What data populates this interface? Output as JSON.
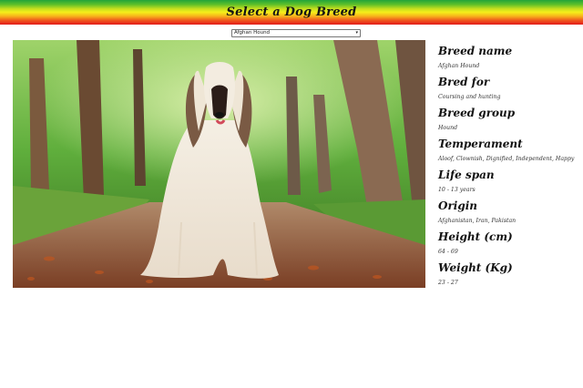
{
  "header": {
    "title": "Select a Dog Breed"
  },
  "selector": {
    "selected": "Afghan Hound"
  },
  "photo": {
    "description_icon": "afghan-hound-photo"
  },
  "details": [
    {
      "heading": "Breed name",
      "value": "Afghan Hound"
    },
    {
      "heading": "Bred for",
      "value": "Coursing and hunting"
    },
    {
      "heading": "Breed group",
      "value": "Hound"
    },
    {
      "heading": "Temperament",
      "value": "Aloof, Clownish, Dignified, Independent, Happy"
    },
    {
      "heading": "Life span",
      "value": "10 - 13 years"
    },
    {
      "heading": "Origin",
      "value": "Afghanistan, Iran, Pakistan"
    },
    {
      "heading": "Height (cm)",
      "value": "64 - 69"
    },
    {
      "heading": "Weight (Kg)",
      "value": "23 - 27"
    }
  ],
  "colors": {
    "banner_top": "#22a43a",
    "banner_mid": "#f6ee1a",
    "banner_bottom": "#e21b1b"
  }
}
